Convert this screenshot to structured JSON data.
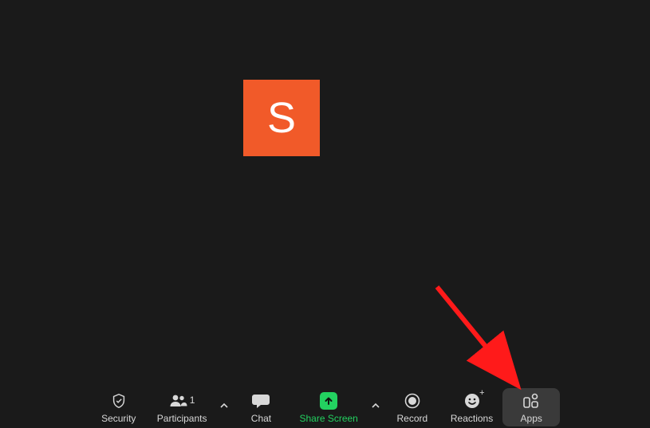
{
  "avatar": {
    "initial": "S"
  },
  "toolbar": {
    "security": {
      "label": "Security"
    },
    "participants": {
      "label": "Participants",
      "count": "1"
    },
    "chat": {
      "label": "Chat"
    },
    "share": {
      "label": "Share Screen"
    },
    "record": {
      "label": "Record"
    },
    "reactions": {
      "label": "Reactions"
    },
    "apps": {
      "label": "Apps"
    }
  }
}
